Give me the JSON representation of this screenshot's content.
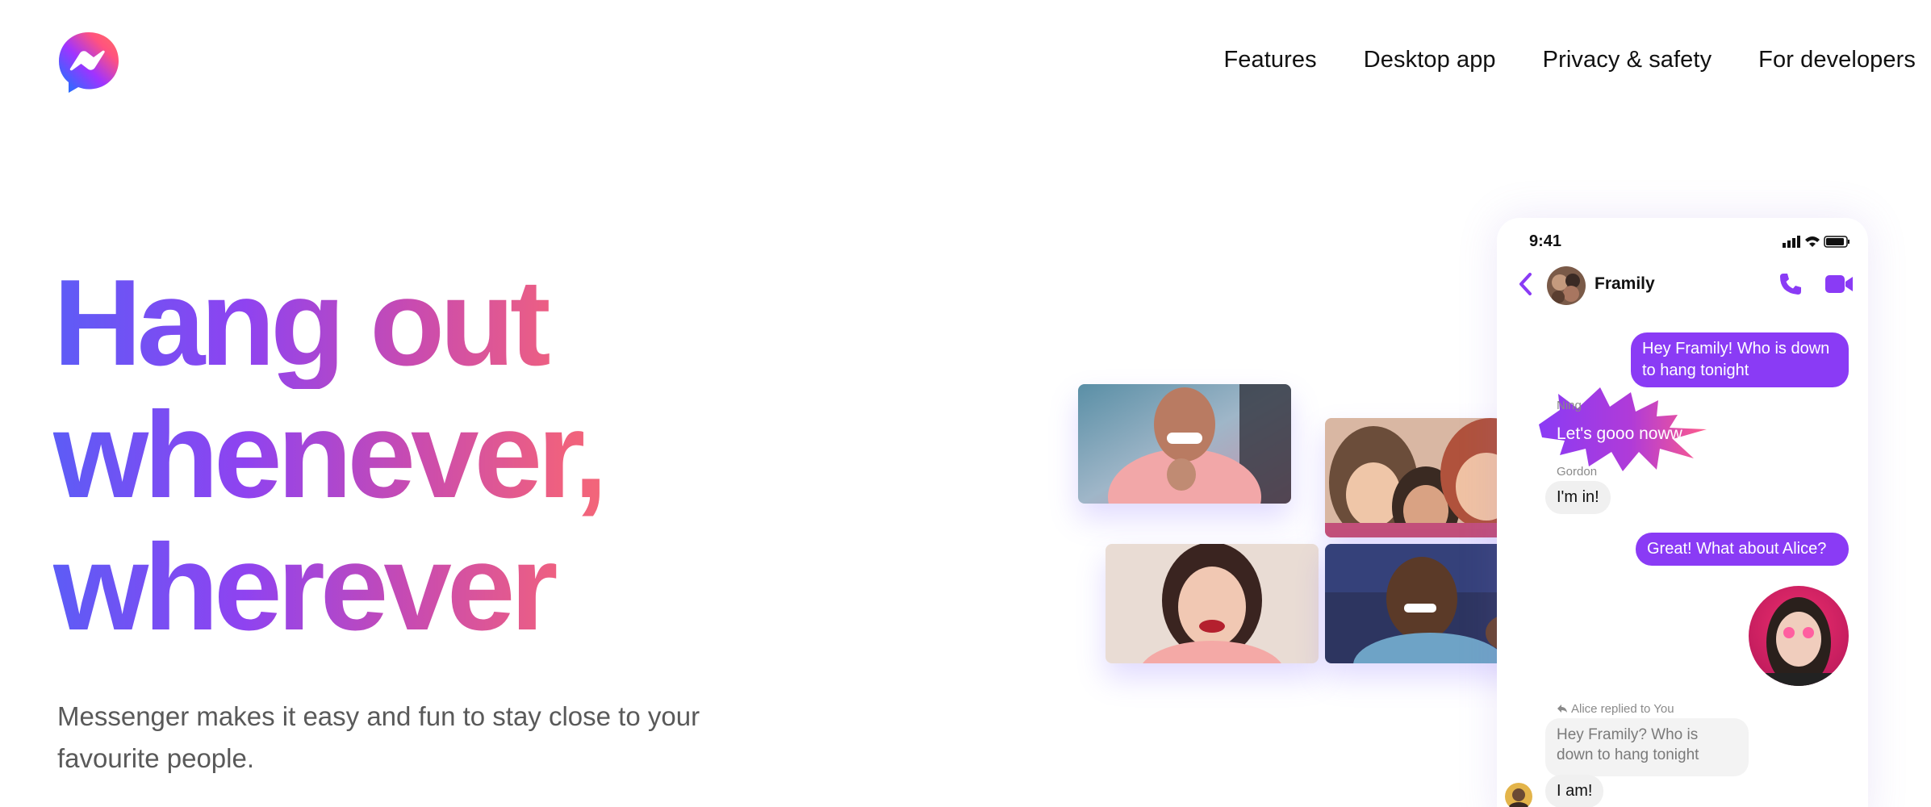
{
  "nav": {
    "features": "Features",
    "desktop_app": "Desktop app",
    "privacy": "Privacy & safety",
    "developers": "For developers"
  },
  "hero": {
    "headline_lines": [
      "Hang out",
      "whenever,",
      "wherever"
    ],
    "subtext": "Messenger makes it easy and fun to stay close to your favourite people."
  },
  "phone": {
    "time": "9:41",
    "chat_name": "Framily",
    "messages": {
      "m1": "Hey Framily! Who is down to hang tonight",
      "ning_sender": "Ning",
      "ning_msg": "Let's gooo noww",
      "gordon_sender": "Gordon",
      "gordon_msg": "I'm in!",
      "m2": "Great! What about Alice?",
      "reply_note": "Alice replied to You",
      "quoted": "Hey Framily? Who is down to hang tonight",
      "alice_msg": "I am!"
    }
  },
  "colors": {
    "brand_purple": "#8a3bf5",
    "gradient_start": "#5d5cf6",
    "gradient_end": "#f46a76"
  },
  "icons": {
    "logo": "messenger-logo-icon",
    "back": "chevron-left-icon",
    "call": "phone-icon",
    "video": "video-camera-icon",
    "reply": "reply-arrow-icon"
  }
}
